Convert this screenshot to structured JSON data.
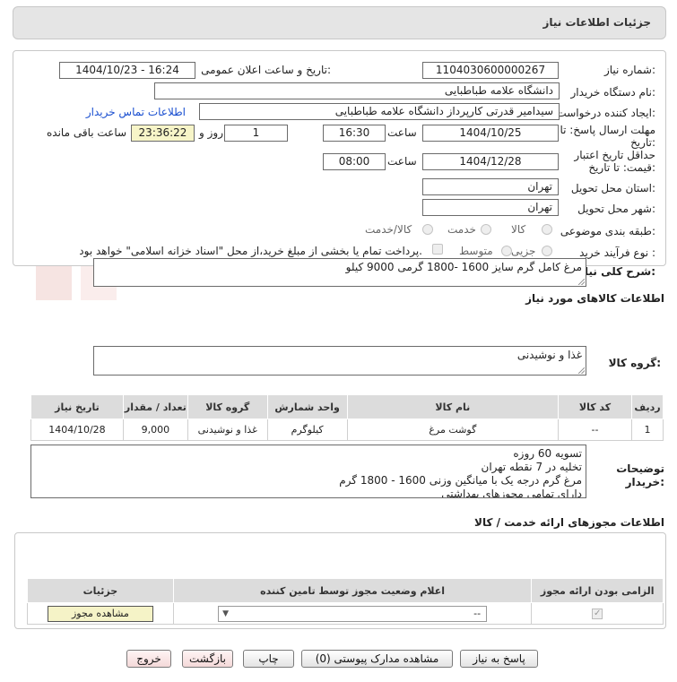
{
  "panel_title": "جزئیات اطلاعات نیاز",
  "fields": {
    "need_number_label": "شماره نیاز:",
    "need_number": "1104030600000267",
    "announce_label": "تاریخ و ساعت اعلان عمومی:",
    "announce_value": "1404/10/23 - 16:24",
    "buyer_org_label": "نام دستگاه خریدار:",
    "buyer_org": "دانشگاه علامه طباطبایی",
    "requester_label": "ایجاد کننده درخواست:",
    "requester": "سیدامیر قدرتی کارپرداز دانشگاه علامه طباطبایی",
    "contact_link": "اطلاعات تماس خریدار",
    "deadline_label_1": "مهلت ارسال پاسخ: تا",
    "deadline_label_2": "تاریخ:",
    "deadline_date": "1404/10/25",
    "time_label": "ساعت",
    "deadline_time": "16:30",
    "days_value": "1",
    "days_label": "روز و",
    "remaining_time": "23:36:22",
    "remaining_label": "ساعت باقی مانده",
    "validity_label_1": "حداقل تاریخ اعتبار",
    "validity_label_2": "قیمت: تا تاریخ:",
    "validity_date": "1404/12/28",
    "validity_time": "08:00",
    "province_label": "استان محل تحویل:",
    "province": "تهران",
    "city_label": "شهر محل تحویل:",
    "city": "تهران",
    "category_label": "طبقه بندی موضوعی:",
    "category_options": [
      "کالا",
      "خدمت",
      "کالا/خدمت"
    ],
    "purchase_type_label": "نوع فرآیند خرید :",
    "purchase_type_options": [
      "جزیی",
      "متوسط"
    ],
    "payment_note": "پرداخت تمام یا بخشی از مبلغ خرید،از محل \"اسناد خزانه اسلامی\" خواهد بود."
  },
  "overall_desc_label": "شرح کلی نیاز:",
  "overall_desc": "مرغ کامل گرم سایز 1600 -1800 گرمی 9000 کیلو",
  "goods_info_title": "اطلاعات کالاهای مورد نیاز",
  "goods_group_label": "گروه کالا:",
  "goods_group": "غذا و نوشیدنی",
  "goods_table": {
    "headers": [
      "ردیف",
      "کد کالا",
      "نام کالا",
      "واحد شمارش",
      "گروه کالا",
      "تعداد / مقدار",
      "تاریخ نیاز"
    ],
    "rows": [
      [
        "1",
        "--",
        "گوشت مرغ",
        "کیلوگرم",
        "غذا و نوشیدنی",
        "9,000",
        "1404/10/28"
      ]
    ]
  },
  "buyer_notes_label_1": "توضیحات",
  "buyer_notes_label_2": "خریدار:",
  "buyer_notes": [
    "تسویه 60 روزه",
    "تخلیه در 7 نقطه تهران",
    "مرغ گرم درجه یک با میانگین وزنی 1600 - 1800 گرم",
    "دارای تمامی مجوزهای بهداشتی"
  ],
  "permits_title": "اطلاعات مجوزهای ارائه خدمت / کالا",
  "permits_table": {
    "headers": [
      "الزامی بودن ارائه مجوز",
      "اعلام وضعیت مجوز توسط تامین کننده",
      "جزئیات"
    ],
    "select_value": "--",
    "view_button": "مشاهده مجوز"
  },
  "buttons": {
    "reply": "پاسخ به نیاز",
    "attachments": "مشاهده مدارک پیوستی (0)",
    "print": "چاپ",
    "back": "بازگشت",
    "exit": "خروج"
  },
  "watermark": "AriaTender.net",
  "colors": {
    "link": "#1a4fd0",
    "header_bg": "#e5e5e5",
    "yellow": "#f7f5c8"
  }
}
